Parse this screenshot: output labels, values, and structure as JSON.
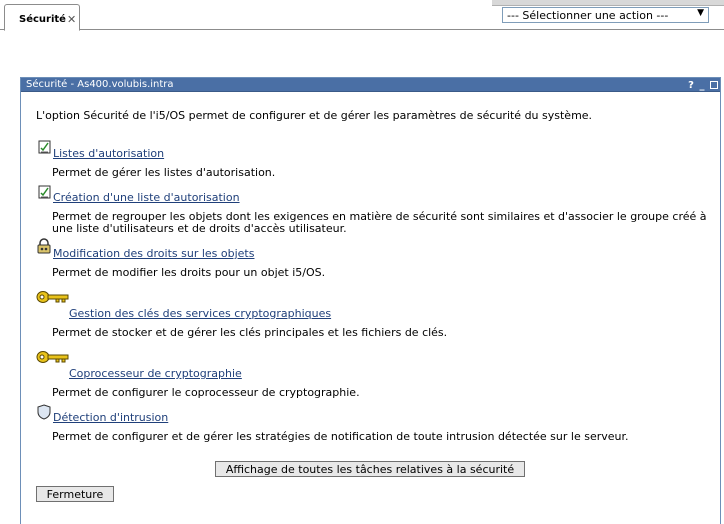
{
  "tab": {
    "label": "Sécurité",
    "close_glyph": "✕"
  },
  "action_select": {
    "selected": "--- Sélectionner une action ---",
    "arrow": "▼"
  },
  "portlet": {
    "title": "Sécurité - As400.volubis.intra",
    "controls": {
      "help": "?",
      "minimize": "_"
    },
    "intro": "L'option Sécurité de l'i5/OS permet de configurer et de gérer les paramètres de sécurité du système.",
    "items": [
      {
        "link": "Listes d'autorisation",
        "desc": "Permet de gérer les listes d'autorisation.",
        "icon": "checklist-icon"
      },
      {
        "link": "Création d'une liste d'autorisation",
        "desc1": "Permet de regrouper les objets dont les exigences en matière de sécurité sont similaires et d'associer le groupe créé à",
        "desc2": "une liste d'utilisateurs et de droits d'accès utilisateur.",
        "icon": "checklist-icon"
      },
      {
        "link": "Modification des droits sur les objets",
        "desc": "Permet de modifier les droits pour un objet i5/OS.",
        "icon": "lock-icon"
      },
      {
        "link": "Gestion des clés des services cryptographiques",
        "desc": "Permet de stocker et de gérer les clés principales et les fichiers de clés.",
        "icon": "key-icon"
      },
      {
        "link": "Coprocesseur de cryptographie",
        "desc": "Permet de configurer le coprocesseur de cryptographie.",
        "icon": "key-icon"
      },
      {
        "link": "Détection d'intrusion",
        "desc": "Permet de configurer et de gérer les stratégies de notification de toute intrusion détectée sur le serveur.",
        "icon": "shield-icon"
      }
    ],
    "show_all_button": "Affichage de toutes les tâches relatives à la sécurité",
    "close_button": "Fermeture"
  },
  "colors": {
    "header_bg": "#4a6fa5",
    "link": "#1f3f7a",
    "key": "#e8c21a"
  }
}
